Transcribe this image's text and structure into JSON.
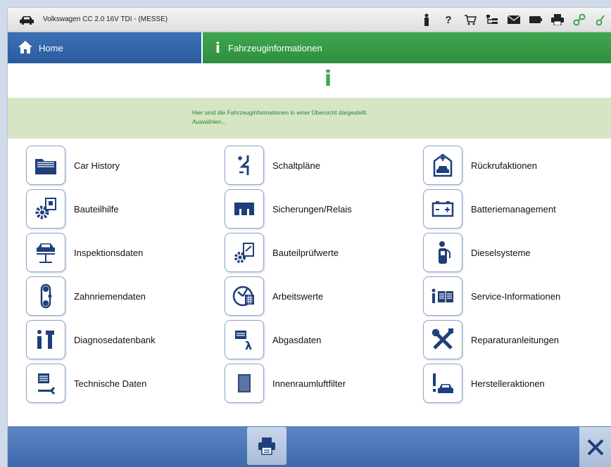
{
  "window": {
    "title": "Volkswagen CC 2.0 16V TDI - (MESSE)"
  },
  "toolbar_icons": [
    "person-icon",
    "help-icon",
    "cart-icon",
    "hierarchy-icon",
    "mail-icon",
    "battery-icon",
    "printer-icon",
    "link-icon",
    "connection-icon"
  ],
  "toolbar": {
    "help_label": "?"
  },
  "nav": {
    "home_label": "Home",
    "info_label": "Fahrzeuginformationen",
    "info_icon": "i"
  },
  "header_icon": "i",
  "info_band": {
    "line1": "Hier sind die Fahrzeuginformationen in einer Übersicht dargestellt.",
    "line2": "Auswählen..."
  },
  "items": {
    "car_history": "Car History",
    "schaltplaene": "Schaltpläne",
    "rueckrufaktionen": "Rückrufaktionen",
    "bauteilhilfe": "Bauteilhilfe",
    "sicherungen": "Sicherungen/Relais",
    "batteriemanagement": "Batteriemanagement",
    "inspektionsdaten": "Inspektionsdaten",
    "bauteilpruefwerte": "Bauteilprüfwerte",
    "dieselsysteme": "Dieselsysteme",
    "zahnriemendaten": "Zahnriemendaten",
    "arbeitswerte": "Arbeitswerte",
    "service_informationen": "Service-Informationen",
    "diagnosedatenbank": "Diagnosedatenbank",
    "abgasdaten": "Abgasdaten",
    "reparaturanleitungen": "Reparaturanleitungen",
    "technische_daten": "Technische Daten",
    "innenraumluftfilter": "Innenraumluftfilter",
    "herstelleraktionen": "Herstelleraktionen"
  },
  "colors": {
    "nav_blue": "#2f5fa3",
    "nav_green": "#3ea64f",
    "info_band": "#d6e6c4",
    "icon_blue": "#1f3f7a"
  }
}
